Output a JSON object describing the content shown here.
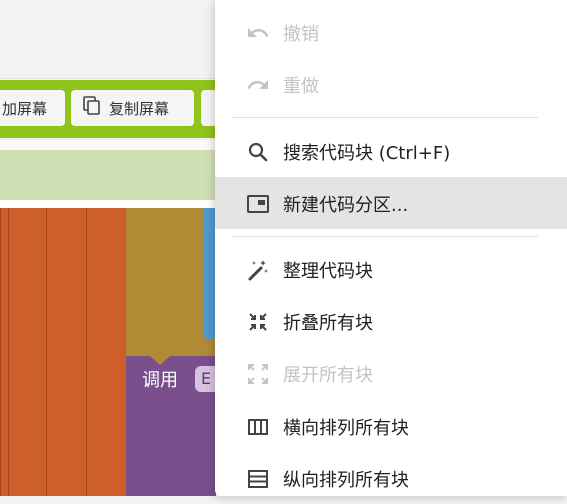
{
  "toolbar": {
    "buttons": [
      {
        "label": "加屏幕",
        "icon": "add-screen-icon"
      },
      {
        "label": "复制屏幕",
        "icon": "copy-icon"
      }
    ]
  },
  "workspace": {
    "call_block_label": "调用",
    "call_block_chip": "E"
  },
  "context_menu": {
    "items": [
      {
        "label": "撤销",
        "icon": "undo-icon",
        "enabled": false
      },
      {
        "label": "重做",
        "icon": "redo-icon",
        "enabled": false
      },
      {
        "label": "搜索代码块 (Ctrl+F)",
        "icon": "search-icon",
        "enabled": true
      },
      {
        "label": "新建代码分区...",
        "icon": "new-section-icon",
        "enabled": true,
        "highlighted": true
      },
      {
        "label": "整理代码块",
        "icon": "magic-wand-icon",
        "enabled": true
      },
      {
        "label": "折叠所有块",
        "icon": "collapse-icon",
        "enabled": true
      },
      {
        "label": "展开所有块",
        "icon": "expand-icon",
        "enabled": false
      },
      {
        "label": "横向排列所有块",
        "icon": "columns-icon",
        "enabled": true
      },
      {
        "label": "纵向排列所有块",
        "icon": "rows-icon",
        "enabled": true
      }
    ]
  },
  "colors": {
    "toolbar_green": "#8fc41a",
    "block_orange": "#cf5f2a",
    "block_gold": "#b08a35",
    "block_purple": "#7a4f8d",
    "block_teal": "#4f9ad0",
    "menu_highlight": "#e4e4e4"
  }
}
